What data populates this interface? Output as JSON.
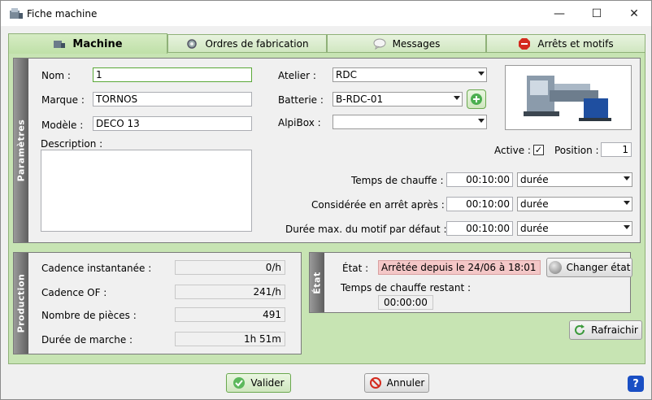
{
  "window": {
    "title": "Fiche machine",
    "minimize": "—",
    "maximize": "☐",
    "close": "✕"
  },
  "tabs": [
    {
      "label": "Machine",
      "icon": "machine-icon"
    },
    {
      "label": "Ordres de fabrication",
      "icon": "fabrication-icon"
    },
    {
      "label": "Messages",
      "icon": "message-icon"
    },
    {
      "label": "Arrêts et motifs",
      "icon": "stop-icon"
    }
  ],
  "parametres": {
    "band": "Paramètres",
    "nom_label": "Nom :",
    "nom_value": "1",
    "marque_label": "Marque :",
    "marque_value": "TORNOS",
    "modele_label": "Modèle :",
    "modele_value": "DECO 13",
    "description_label": "Description :",
    "description_value": "",
    "atelier_label": "Atelier :",
    "atelier_value": "RDC",
    "batterie_label": "Batterie :",
    "batterie_value": "B-RDC-01",
    "alpibox_label": "AlpiBox :",
    "alpibox_value": "",
    "active_label": "Active :",
    "active_checked": "✓",
    "position_label": "Position :",
    "position_value": "1",
    "chauffe_label": "Temps de chauffe :",
    "chauffe_value": "00:10:00",
    "chauffe_unit": "durée",
    "arret_label": "Considérée en arrêt après :",
    "arret_value": "00:10:00",
    "arret_unit": "durée",
    "motif_label": "Durée max. du motif par défaut :",
    "motif_value": "00:10:00",
    "motif_unit": "durée"
  },
  "production": {
    "band": "Production",
    "cadence_inst_label": "Cadence instantanée :",
    "cadence_inst_value": "0/h",
    "cadence_of_label": "Cadence OF :",
    "cadence_of_value": "241/h",
    "pieces_label": "Nombre de pièces :",
    "pieces_value": "491",
    "marche_label": "Durée de marche :",
    "marche_value": "1h 51m"
  },
  "etat": {
    "band": "État",
    "etat_label": "État :",
    "etat_value": "Arrêtée depuis le 24/06 à 18:01",
    "changer_label": "Changer état",
    "chauffe_restant_label": "Temps de chauffe restant :",
    "chauffe_restant_value": "00:00:00"
  },
  "buttons": {
    "rafraichir": "Rafraichir",
    "valider": "Valider",
    "annuler": "Annuler",
    "help": "?"
  },
  "colors": {
    "accent_green": "#c7e4b3",
    "status_red": "#f4c7c7",
    "help_blue": "#1a4fc4"
  }
}
